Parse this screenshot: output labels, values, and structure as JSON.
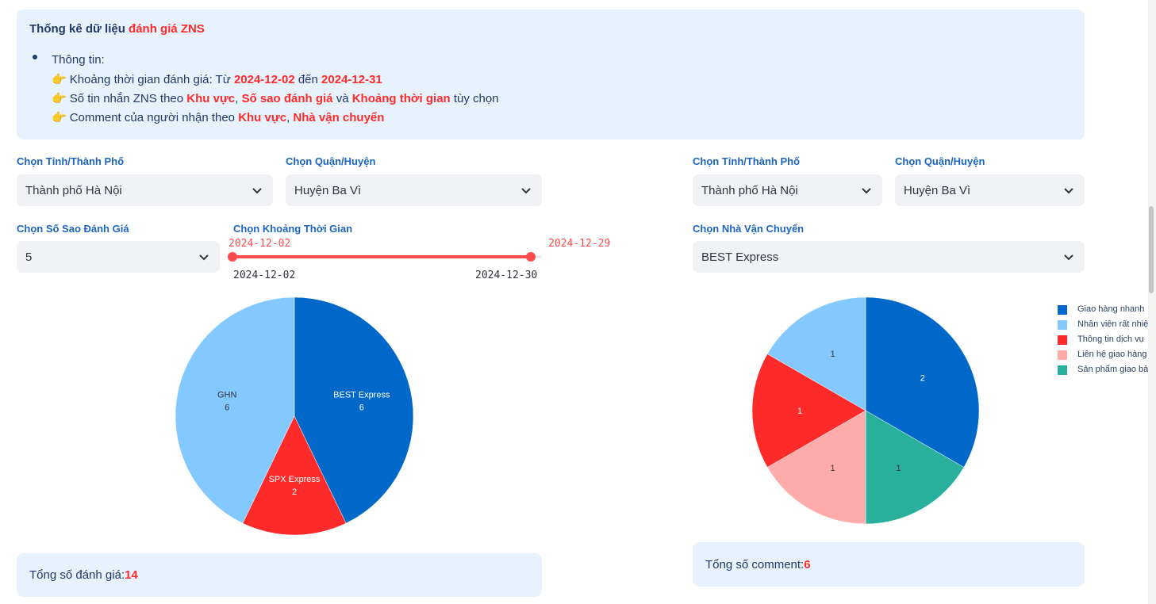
{
  "info": {
    "title_prefix": "Thống kê dữ liệu ",
    "title_highlight": "đánh giá ZNS",
    "bullet_label": "Thông tin:",
    "line1_prefix": "Khoảng thời gian đánh giá: Từ ",
    "line1_from": "2024-12-02",
    "line1_mid": " đến ",
    "line1_to": "2024-12-31",
    "line2_prefix": "Số tin nhắn ZNS theo ",
    "line2_h1": "Khu vực",
    "line2_sep1": ", ",
    "line2_h2": "Số sao đánh giá",
    "line2_sep2": " và ",
    "line2_h3": "Khoảng thời gian",
    "line2_suffix": " tùy chọn",
    "line3_prefix": "Comment của người nhận theo ",
    "line3_h1": "Khu vực",
    "line3_sep": ", ",
    "line3_h2": "Nhà vận chuyển",
    "hand_glyph": "👉"
  },
  "left": {
    "province_label": "Chọn Tỉnh/Thành Phố",
    "province_value": "Thành phố Hà Nội",
    "district_label": "Chọn Quận/Huyện",
    "district_value": "Huyện Ba Vì",
    "stars_label": "Chọn Số Sao Đánh Giá",
    "stars_value": "5",
    "range_label": "Chọn Khoảng Thời Gian",
    "range_start": "2024-12-02",
    "range_end": "2024-12-29",
    "range_min": "2024-12-02",
    "range_max": "2024-12-30",
    "summary_label": "Tổng số đánh giá: ",
    "summary_value": "14"
  },
  "right": {
    "province_label": "Chọn Tỉnh/Thành Phố",
    "province_value": "Thành phố Hà Nội",
    "district_label": "Chọn Quận/Huyện",
    "district_value": "Huyện Ba Vì",
    "carrier_label": "Chọn Nhà Vận Chuyển",
    "carrier_value": "BEST Express",
    "summary_label": "Tổng số comment: ",
    "summary_value": "6",
    "legend": [
      {
        "label": "Giao hàng nhanh",
        "color": "#0068c9"
      },
      {
        "label": "Nhân viên rất nhiệ",
        "color": "#83c9ff"
      },
      {
        "label": "Thông tin dịch vụ",
        "color": "#ff2b2b"
      },
      {
        "label": "Liên hệ giao hàng",
        "color": "#ffabab"
      },
      {
        "label": "Sản phẩm giao bả",
        "color": "#29b09d"
      }
    ]
  },
  "chart_data": [
    {
      "type": "pie",
      "slices": [
        {
          "label": "BEST Express",
          "value": 6,
          "color": "#0068c9",
          "text_color": "#ffffff"
        },
        {
          "label": "SPX Express",
          "value": 2,
          "color": "#ff2b2b",
          "text_color": "#ffffff"
        },
        {
          "label": "GHN",
          "value": 6,
          "color": "#83c9ff",
          "text_color": "#31333f"
        }
      ]
    },
    {
      "type": "pie",
      "slices": [
        {
          "label": "Giao hàng nhanh",
          "value": 2,
          "color": "#0068c9",
          "text_color": "#ffffff"
        },
        {
          "label": "Sản phẩm giao bả",
          "value": 1,
          "color": "#29b09d",
          "text_color": "#31333f"
        },
        {
          "label": "Liên hệ giao hàng",
          "value": 1,
          "color": "#ffabab",
          "text_color": "#31333f"
        },
        {
          "label": "Thông tin dịch vụ",
          "value": 1,
          "color": "#ff2b2b",
          "text_color": "#ffffff"
        },
        {
          "label": "Nhân viên rất nhiệ",
          "value": 1,
          "color": "#83c9ff",
          "text_color": "#31333f"
        }
      ]
    }
  ]
}
